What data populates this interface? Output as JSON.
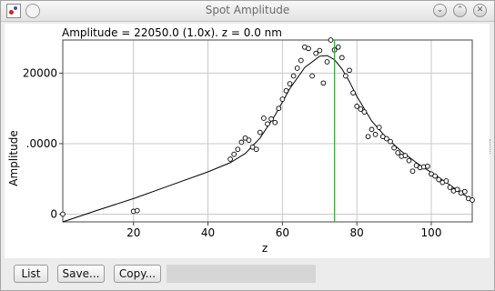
{
  "window": {
    "title": "Spot Amplitude",
    "controls": {
      "minimize": "⌄",
      "maximize": "⌃",
      "close": "✕"
    }
  },
  "plot": {
    "header": "Amplitude = 22050.0 (1.0x). z = 0.0 nm",
    "xlabel": "z",
    "ylabel": "Amplitude",
    "y_tick_labels": [
      "20000",
      ".0000",
      "0"
    ],
    "x_tick_labels": [
      "20",
      "40",
      "60",
      "80",
      "100"
    ],
    "colors": {
      "points": "#000000",
      "curve": "#000000",
      "cursor": "#00cc00",
      "grid": "#c8c8c8"
    }
  },
  "chart_data": {
    "type": "scatter",
    "title": "Amplitude = 22050.0 (1.0x). z = 0.0 nm",
    "xlabel": "z",
    "ylabel": "Amplitude",
    "xlim": [
      1,
      111
    ],
    "ylim": [
      -1100,
      24700
    ],
    "y_ticks": [
      0,
      10000,
      20000
    ],
    "x_ticks": [
      20,
      40,
      60,
      80,
      100
    ],
    "grid": true,
    "cursor_x": 74,
    "points": [
      [
        1,
        0
      ],
      [
        20,
        400
      ],
      [
        21,
        500
      ],
      [
        46,
        7800
      ],
      [
        47,
        8500
      ],
      [
        48,
        9200
      ],
      [
        49,
        10200
      ],
      [
        50,
        10800
      ],
      [
        51,
        10500
      ],
      [
        52,
        9500
      ],
      [
        53,
        9200
      ],
      [
        54,
        11600
      ],
      [
        55,
        13600
      ],
      [
        56,
        12800
      ],
      [
        57,
        13500
      ],
      [
        58,
        13000
      ],
      [
        59,
        15000
      ],
      [
        60,
        16300
      ],
      [
        61,
        17500
      ],
      [
        62,
        18500
      ],
      [
        63,
        19600
      ],
      [
        64,
        20700
      ],
      [
        65,
        21800
      ],
      [
        66,
        23700
      ],
      [
        67,
        23500
      ],
      [
        68,
        19600
      ],
      [
        69,
        22800
      ],
      [
        70,
        23200
      ],
      [
        71,
        18600
      ],
      [
        72,
        21600
      ],
      [
        73,
        24700
      ],
      [
        74,
        23300
      ],
      [
        75,
        23700
      ],
      [
        76,
        22200
      ],
      [
        77,
        19600
      ],
      [
        78,
        20400
      ],
      [
        79,
        17200
      ],
      [
        80,
        15300
      ],
      [
        81,
        14900
      ],
      [
        82,
        14500
      ],
      [
        83,
        11000
      ],
      [
        84,
        12000
      ],
      [
        85,
        11300
      ],
      [
        86,
        12300
      ],
      [
        87,
        11000
      ],
      [
        88,
        10700
      ],
      [
        89,
        10300
      ],
      [
        90,
        9400
      ],
      [
        91,
        8700
      ],
      [
        92,
        8200
      ],
      [
        93,
        8300
      ],
      [
        94,
        7600
      ],
      [
        95,
        6100
      ],
      [
        96,
        6900
      ],
      [
        97,
        6600
      ],
      [
        98,
        6700
      ],
      [
        99,
        6800
      ],
      [
        100,
        5700
      ],
      [
        101,
        5400
      ],
      [
        102,
        4900
      ],
      [
        103,
        4500
      ],
      [
        104,
        4700
      ],
      [
        105,
        3800
      ],
      [
        106,
        3300
      ],
      [
        107,
        3500
      ],
      [
        108,
        3000
      ],
      [
        109,
        3200
      ],
      [
        110,
        2200
      ],
      [
        111,
        2000
      ]
    ],
    "fit_curve": [
      [
        1,
        -1100
      ],
      [
        10,
        500
      ],
      [
        20,
        2200
      ],
      [
        30,
        4100
      ],
      [
        40,
        6000
      ],
      [
        46,
        7300
      ],
      [
        50,
        8600
      ],
      [
        54,
        10800
      ],
      [
        58,
        14000
      ],
      [
        62,
        17800
      ],
      [
        66,
        20800
      ],
      [
        70,
        22400
      ],
      [
        72,
        22500
      ],
      [
        74,
        21900
      ],
      [
        76,
        20600
      ],
      [
        78,
        18800
      ],
      [
        80,
        16700
      ],
      [
        84,
        13200
      ],
      [
        88,
        10800
      ],
      [
        92,
        8900
      ],
      [
        96,
        7300
      ],
      [
        100,
        5900
      ],
      [
        104,
        4500
      ],
      [
        108,
        3000
      ],
      [
        111,
        2000
      ]
    ]
  },
  "footer": {
    "list_label": "List",
    "save_label": "Save...",
    "copy_label": "Copy...",
    "status_text": ""
  }
}
